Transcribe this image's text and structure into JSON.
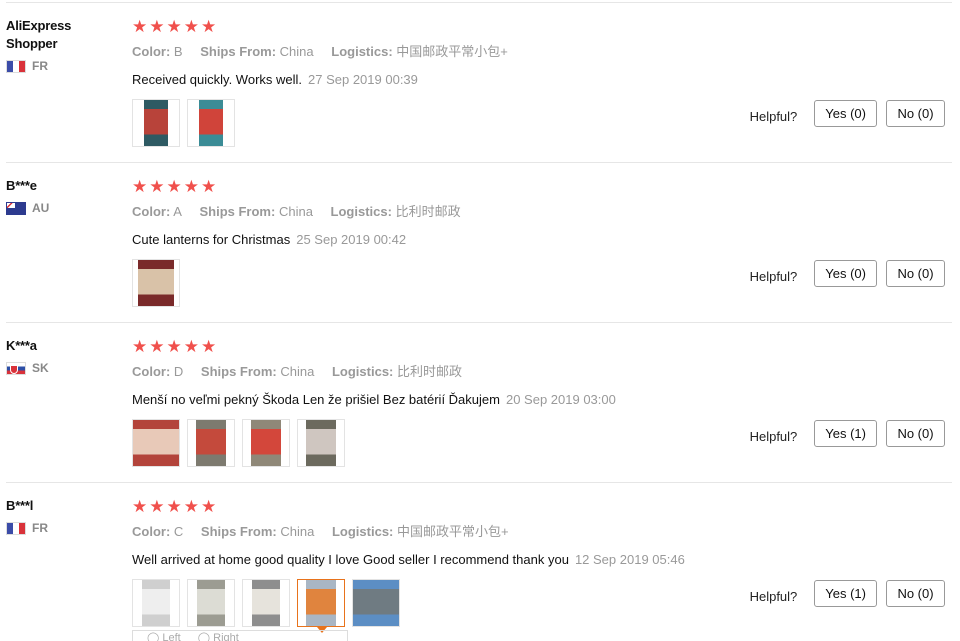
{
  "labels": {
    "color": "Color:",
    "ships_from": "Ships From:",
    "logistics": "Logistics:",
    "helpful": "Helpful?"
  },
  "stars_glyph": "★★★★★",
  "reviews": [
    {
      "user": "AliExpress Shopper",
      "country": "FR",
      "flag": "fr",
      "color": "B",
      "ships_from": "China",
      "logistics": "中国邮政平常小包+",
      "text": "Received quickly. Works well.",
      "date": "27 Sep 2019 00:39",
      "yes": "Yes (0)",
      "no": "No (0)",
      "photos": [
        {
          "bg": "#2e5a63",
          "fg": "#b8433a"
        },
        {
          "bg": "#3b8c96",
          "fg": "#d0443a"
        }
      ]
    },
    {
      "user": "B***e",
      "country": "AU",
      "flag": "au",
      "color": "A",
      "ships_from": "China",
      "logistics": "比利时邮政",
      "text": "Cute lanterns for Christmas",
      "date": "25 Sep 2019 00:42",
      "yes": "Yes (0)",
      "no": "No (0)",
      "photos": [
        {
          "bg": "#7a2a2a",
          "fg": "#d9c2a8"
        }
      ]
    },
    {
      "user": "K***a",
      "country": "SK",
      "flag": "sk",
      "color": "D",
      "ships_from": "China",
      "logistics": "比利时邮政",
      "text": "Menší no veľmi pekný Škoda Len že prišiel Bez batérií Ďakujem",
      "date": "20 Sep 2019 03:00",
      "yes": "Yes (1)",
      "no": "No (0)",
      "photos": [
        {
          "bg": "#b3443b",
          "fg": "#e8c9b8"
        },
        {
          "bg": "#7d7a6f",
          "fg": "#c44a3c"
        },
        {
          "bg": "#8f8878",
          "fg": "#d3473b"
        },
        {
          "bg": "#6c6a5e",
          "fg": "#cfc6c0"
        }
      ]
    },
    {
      "user": "B***l",
      "country": "FR",
      "flag": "fr",
      "color": "C",
      "ships_from": "China",
      "logistics": "中国邮政平常小包+",
      "text": "Well arrived at home good quality I love Good seller I recommend thank you",
      "date": "12 Sep 2019 05:46",
      "yes": "Yes (1)",
      "no": "No (0)",
      "photos": [
        {
          "bg": "#cfcfcf",
          "fg": "#eeeeee"
        },
        {
          "bg": "#9c9c92",
          "fg": "#dcdcd4"
        },
        {
          "bg": "#8e8e8e",
          "fg": "#e6e3dc"
        },
        {
          "bg": "#a9b6c4",
          "fg": "#e0843e"
        },
        {
          "bg": "#5c8ec4",
          "fg": "#6f7b82"
        }
      ]
    }
  ],
  "rotate": {
    "left": "◯ Left",
    "right": "◯ Right"
  }
}
